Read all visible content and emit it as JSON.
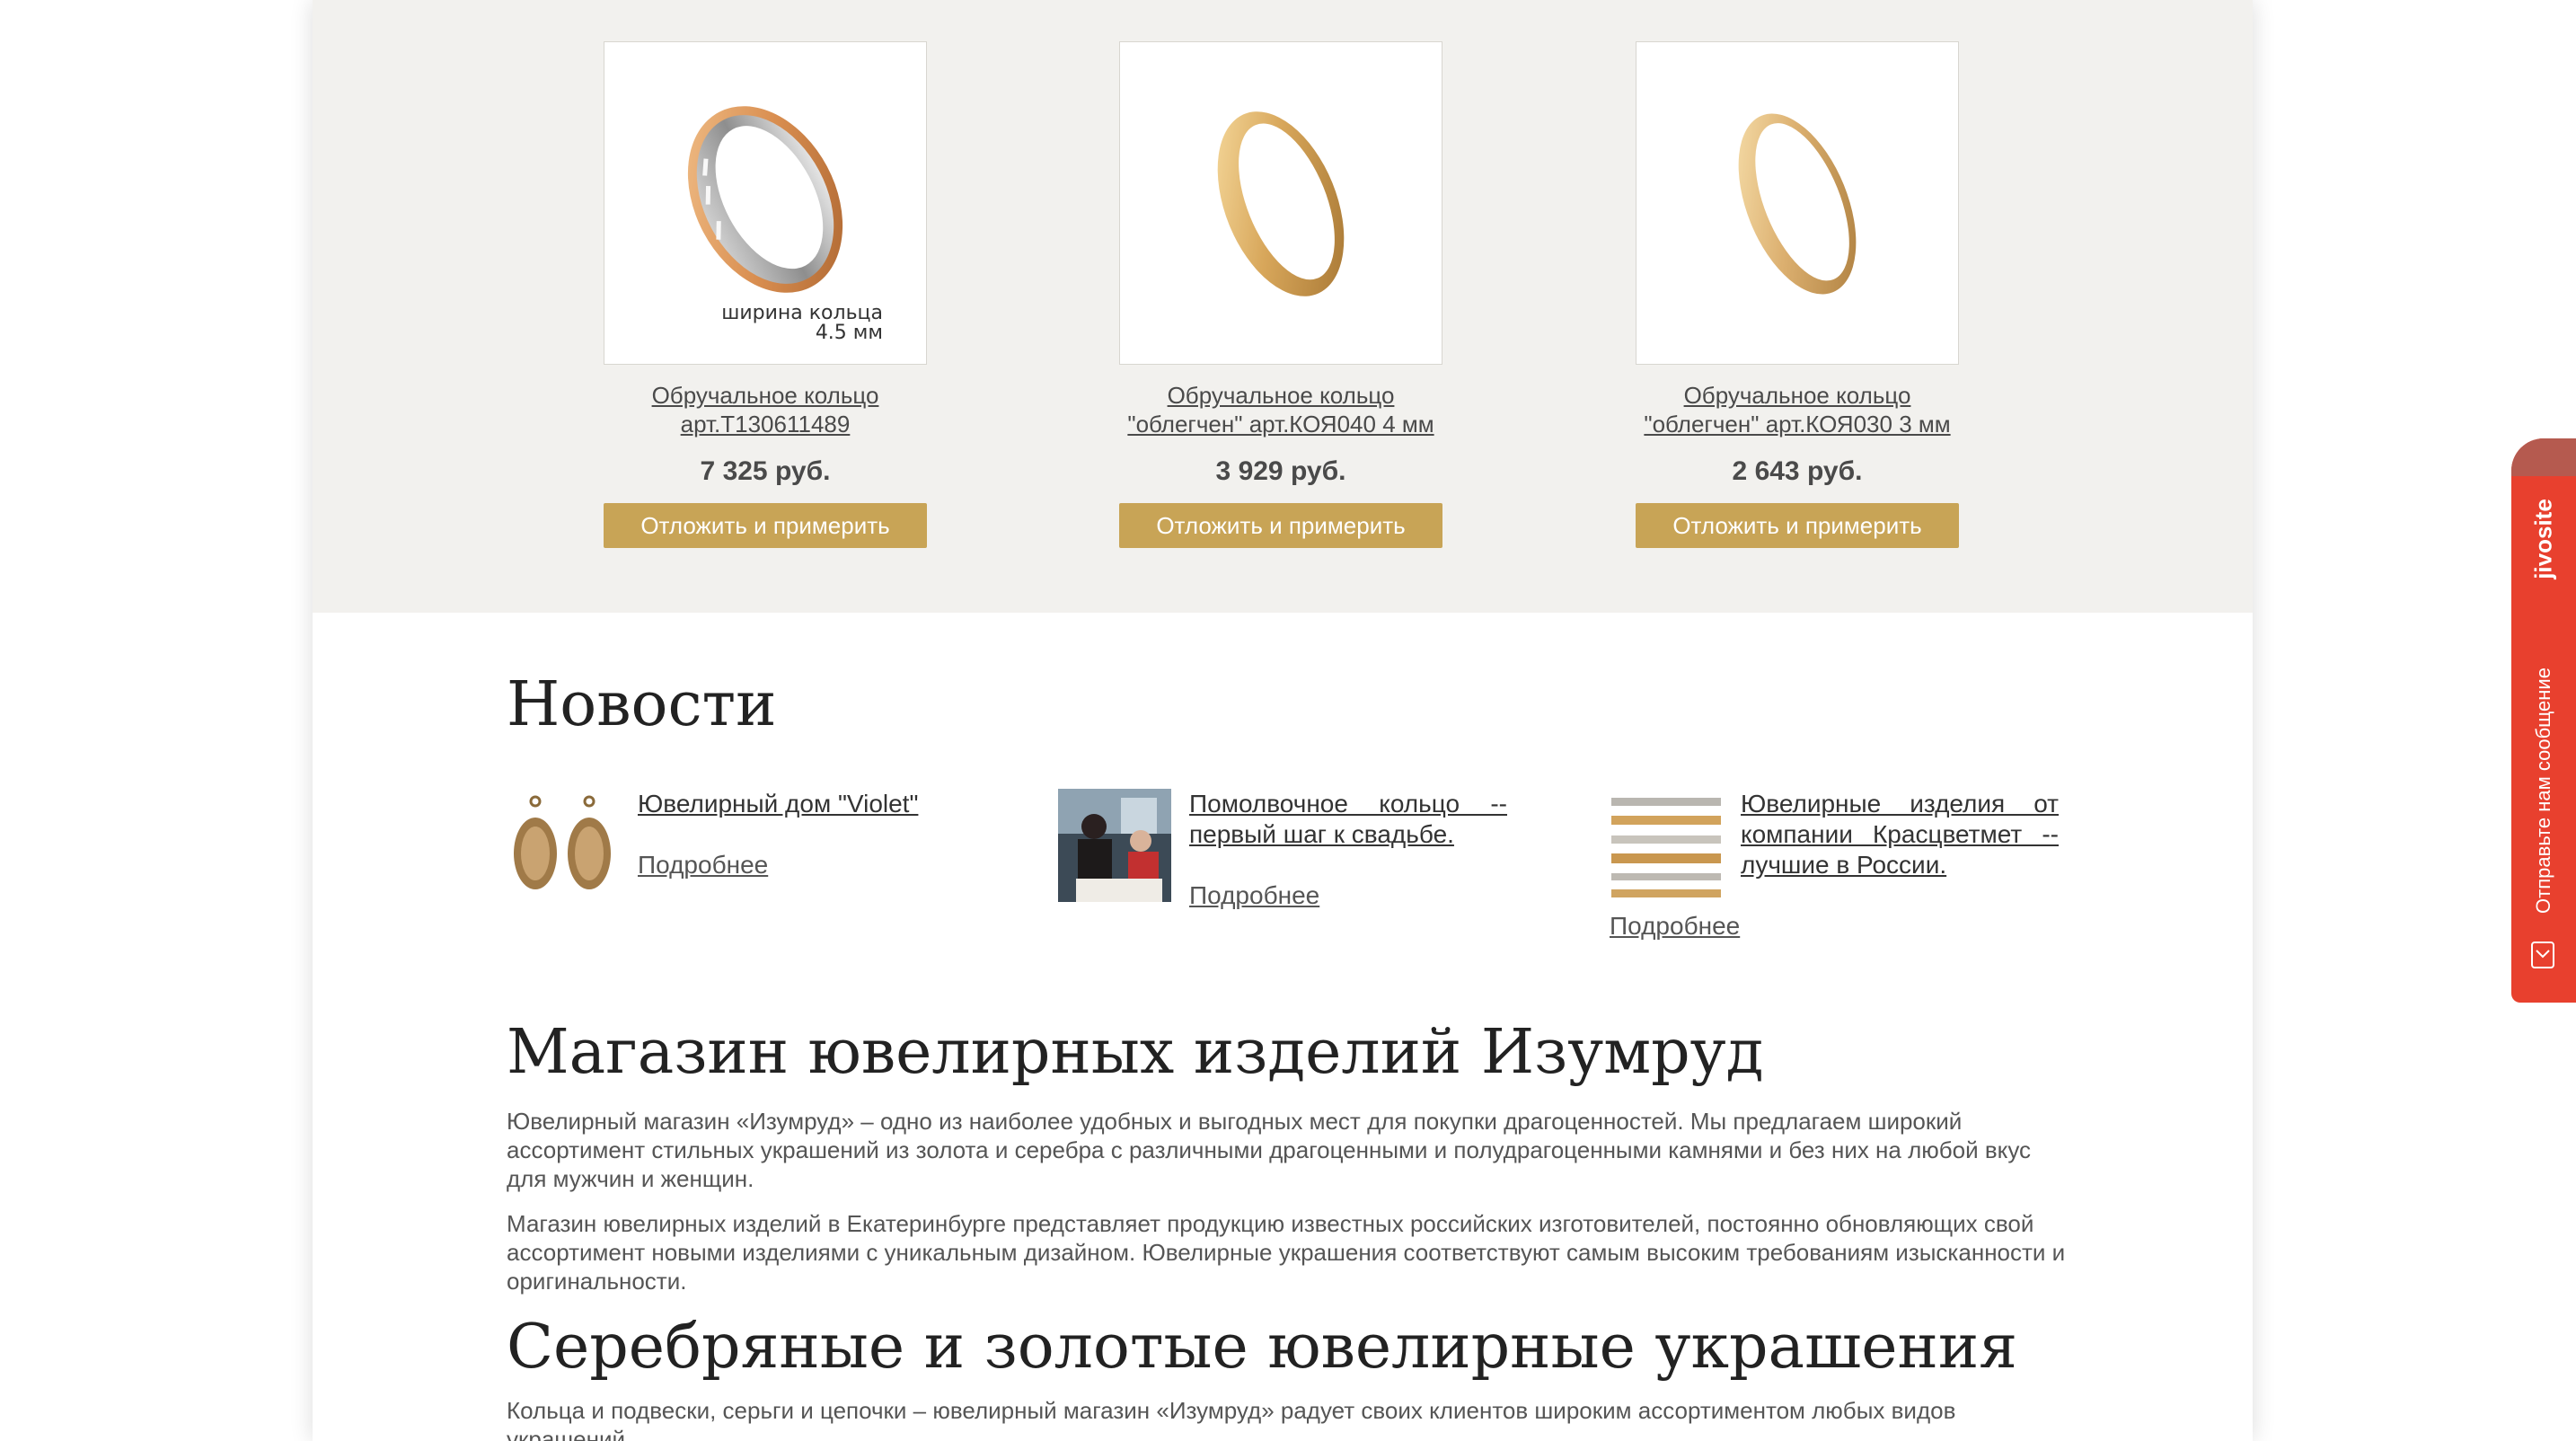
{
  "products": [
    {
      "name_line1": "Обручальное кольцо",
      "name_line2": "арт.Т130611489",
      "price": "7 325 руб.",
      "button": "Отложить и примерить",
      "image_caption_line1": "ширина кольца",
      "image_caption_line2": "4.5 мм"
    },
    {
      "name_line1": "Обручальное кольцо",
      "name_line2": "\"облегчен\" арт.КОЯ040 4 мм",
      "price": "3 929 руб.",
      "button": "Отложить и примерить"
    },
    {
      "name_line1": "Обручальное кольцо",
      "name_line2": "\"облегчен\" арт.КОЯ030 3 мм",
      "price": "2 643 руб.",
      "button": "Отложить и примерить"
    }
  ],
  "news": {
    "heading": "Новости",
    "items": [
      {
        "title": "Ювелирный дом \"Violet\"",
        "more": "Подробнее"
      },
      {
        "title": "Помолвочное кольцо -- первый шаг к свадьбе.",
        "more": "Подробнее"
      },
      {
        "title": "Ювелирные изделия от компании Красцветмет -- лучшие в России.",
        "more": "Подробнее"
      }
    ]
  },
  "about": {
    "heading": "Магазин ювелирных изделий Изумруд",
    "paragraph1": "Ювелирный магазин «Изумруд» – одно из наиболее удобных и выгодных мест для покупки драгоценностей. Мы предлагаем широкий ассортимент стильных украшений из золота и серебра с различными драгоценными и полудрагоценными камнями и без них на любой вкус для мужчин и женщин.",
    "paragraph2": "Магазин ювелирных изделий в Екатеринбурге представляет продукцию известных российских изготовителей, постоянно обновляющих свой ассортимент новыми изделиями с уникальным дизайном. Ювелирные украшения соответствуют самым высоким требованиям изысканности и оригинальности."
  },
  "jewelry": {
    "heading": "Серебряные и золотые ювелирные украшения",
    "paragraph": "Кольца и подвески, серьги и цепочки – ювелирный магазин «Изумруд» радует своих клиентов широким ассортиментом любых видов украшений."
  },
  "chat_widget": {
    "brand": "jivosite",
    "message": "Отправьте нам сообщение"
  },
  "colors": {
    "accent_button": "#c8a456",
    "products_background": "#f2f1ee",
    "widget": "#e8402e"
  }
}
